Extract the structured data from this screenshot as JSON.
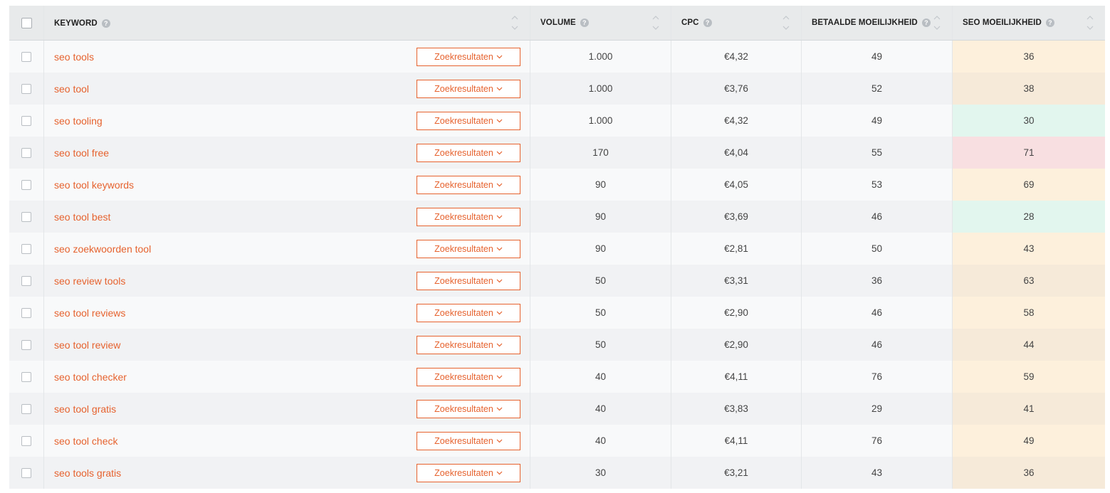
{
  "columns": {
    "keyword": "KEYWORD",
    "volume": "VOLUME",
    "cpc": "CPC",
    "paid_difficulty": "BETAALDE MOEILIJKHEID",
    "seo_difficulty": "SEO MOEILIJKHEID",
    "help_glyph": "?"
  },
  "button_label": "Zoekresultaten",
  "colors": {
    "accent": "#e6622e",
    "seo_easy": "#e2f6ee",
    "seo_medium": "#fdf0dc",
    "seo_hard": "#f8dfe1"
  },
  "rows": [
    {
      "keyword": "seo tools",
      "volume": "1.000",
      "cpc": "€4,32",
      "paid": "49",
      "seo": "36",
      "seo_level": "orange"
    },
    {
      "keyword": "seo tool",
      "volume": "1.000",
      "cpc": "€3,76",
      "paid": "52",
      "seo": "38",
      "seo_level": "beige"
    },
    {
      "keyword": "seo tooling",
      "volume": "1.000",
      "cpc": "€4,32",
      "paid": "49",
      "seo": "30",
      "seo_level": "green"
    },
    {
      "keyword": "seo tool free",
      "volume": "170",
      "cpc": "€4,04",
      "paid": "55",
      "seo": "71",
      "seo_level": "red"
    },
    {
      "keyword": "seo tool keywords",
      "volume": "90",
      "cpc": "€4,05",
      "paid": "53",
      "seo": "69",
      "seo_level": "orange"
    },
    {
      "keyword": "seo tool best",
      "volume": "90",
      "cpc": "€3,69",
      "paid": "46",
      "seo": "28",
      "seo_level": "green"
    },
    {
      "keyword": "seo zoekwoorden tool",
      "volume": "90",
      "cpc": "€2,81",
      "paid": "50",
      "seo": "43",
      "seo_level": "orange"
    },
    {
      "keyword": "seo review tools",
      "volume": "50",
      "cpc": "€3,31",
      "paid": "36",
      "seo": "63",
      "seo_level": "beige"
    },
    {
      "keyword": "seo tool reviews",
      "volume": "50",
      "cpc": "€2,90",
      "paid": "46",
      "seo": "58",
      "seo_level": "orange"
    },
    {
      "keyword": "seo tool review",
      "volume": "50",
      "cpc": "€2,90",
      "paid": "46",
      "seo": "44",
      "seo_level": "beige"
    },
    {
      "keyword": "seo tool checker",
      "volume": "40",
      "cpc": "€4,11",
      "paid": "76",
      "seo": "59",
      "seo_level": "orange"
    },
    {
      "keyword": "seo tool gratis",
      "volume": "40",
      "cpc": "€3,83",
      "paid": "29",
      "seo": "41",
      "seo_level": "beige"
    },
    {
      "keyword": "seo tool check",
      "volume": "40",
      "cpc": "€4,11",
      "paid": "76",
      "seo": "49",
      "seo_level": "orange"
    },
    {
      "keyword": "seo tools gratis",
      "volume": "30",
      "cpc": "€3,21",
      "paid": "43",
      "seo": "36",
      "seo_level": "beige"
    }
  ]
}
